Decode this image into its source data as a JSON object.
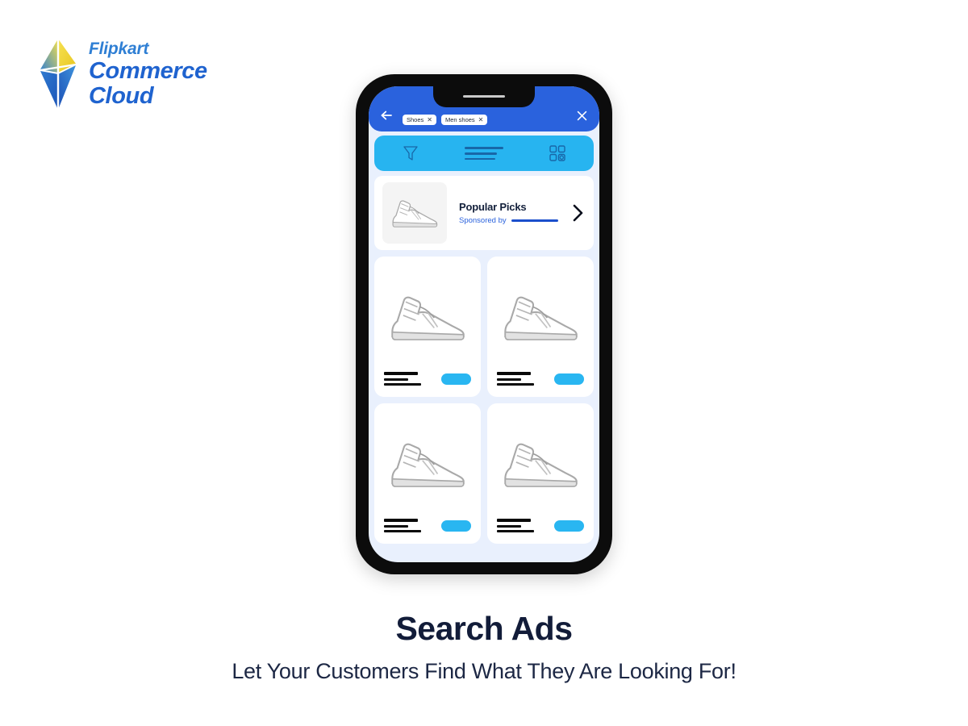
{
  "brand": {
    "line1": "Flipkart",
    "line2": "Commerce",
    "line3": "Cloud",
    "mark_icon": "diamond-kite-logo-icon",
    "colors": {
      "script_blue": "#2f7fd4",
      "bold_blue": "#1f63cf",
      "mark_yellow": "#f2d325",
      "mark_blue": "#1f63cf"
    }
  },
  "phone": {
    "frame_color": "#0c0c0c",
    "screen_bg": "#e9f0fd",
    "notch_icon": "phone-notch",
    "speaker_icon": "speaker-grille-icon"
  },
  "app": {
    "header": {
      "background": "#2a62dd",
      "back_icon": "back-arrow-icon",
      "close_icon": "close-icon",
      "chips": [
        {
          "label": "Shoes",
          "remove_icon": "chip-remove-icon",
          "remove_glyph": "✕"
        },
        {
          "label": "Men shoes",
          "remove_icon": "chip-remove-icon",
          "remove_glyph": "✕"
        }
      ]
    },
    "toolbar": {
      "background": "#27b4f0",
      "filter_icon": "filter-funnel-icon",
      "sort_icon": "sort-lines-icon",
      "grid_icon": "grid-view-icon"
    },
    "promo": {
      "title": "Popular Picks",
      "sponsored_label": "Sponsored by",
      "sponsor_bar_color": "#1b4fcc",
      "thumb_icon": "sneaker-thumbnail-icon",
      "chevron_icon": "chevron-right-icon"
    },
    "products": [
      {
        "image_icon": "sneaker-product-icon",
        "cta_color": "#29b6f1"
      },
      {
        "image_icon": "sneaker-product-icon",
        "cta_color": "#29b6f1"
      },
      {
        "image_icon": "sneaker-product-icon",
        "cta_color": "#29b6f1"
      },
      {
        "image_icon": "sneaker-product-icon",
        "cta_color": "#29b6f1"
      }
    ]
  },
  "footer": {
    "headline": "Search Ads",
    "subheadline": "Let Your Customers Find What They Are Looking For!",
    "headline_color": "#121c39"
  }
}
